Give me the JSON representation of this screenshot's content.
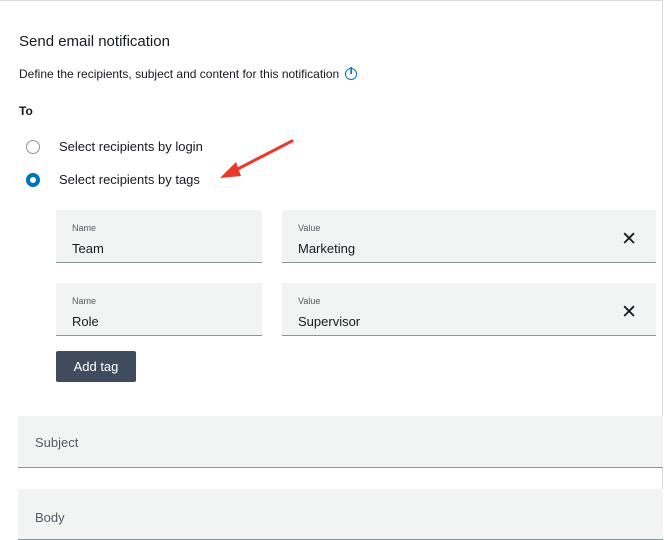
{
  "title": "Send email notification",
  "description": "Define the recipients, subject and content for this notification",
  "info_icon": "info-circle-icon",
  "to_label": "To",
  "radio_options": [
    {
      "label": "Select recipients by login",
      "checked": false
    },
    {
      "label": "Select recipients by tags",
      "checked": true
    }
  ],
  "accent_color": "#0073bb",
  "annotation_arrow_color": "#e8392b",
  "tags": [
    {
      "name_label": "Name",
      "name_value": "Team",
      "value_label": "Value",
      "value_value": "Marketing"
    },
    {
      "name_label": "Name",
      "name_value": "Role",
      "value_label": "Value",
      "value_value": "Supervisor"
    }
  ],
  "remove_icon": "close-icon",
  "add_tag_label": "Add tag",
  "sections": {
    "subject": "Subject",
    "body": "Body"
  }
}
